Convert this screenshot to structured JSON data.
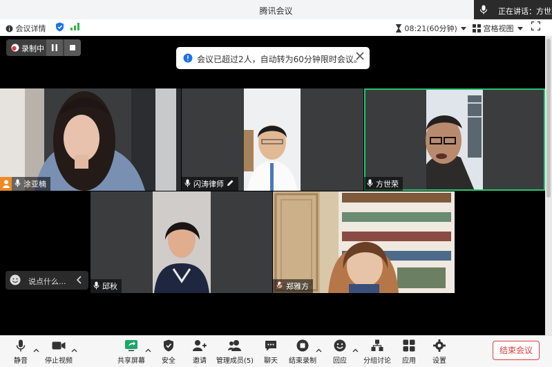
{
  "window": {
    "title": "腾讯会议"
  },
  "speaking": {
    "label": "正在讲话：方世荣"
  },
  "infobar": {
    "details_label": "会议详情",
    "time_label": "08:21(60分钟)",
    "view_label": "宫格视图"
  },
  "recording": {
    "label": "录制中"
  },
  "notice": {
    "text": "会议已超过2人，自动转为60分钟限时会议。"
  },
  "participants": [
    {
      "name": "涂亚楠"
    },
    {
      "name": "闪涛律师"
    },
    {
      "name": "方世荣"
    },
    {
      "name": "邱秋"
    },
    {
      "name": "郑雅方"
    }
  ],
  "chat": {
    "placeholder": "说点什么..."
  },
  "toolbar": {
    "mute": "静音",
    "stop_video": "停止视频",
    "share": "共享屏幕",
    "security": "安全",
    "invite": "邀请",
    "members": "管理成员(5)",
    "chat": "聊天",
    "end_record": "结束录制",
    "reaction": "回应",
    "breakout": "分组讨论",
    "apps": "应用",
    "settings": "设置",
    "end_meeting": "结束会议"
  },
  "colors": {
    "active_speaker": "#27c46d",
    "end_button": "#e3393b",
    "share_icon": "#1ca66b",
    "signal": "#2fb54a",
    "info": "#1a73e8"
  }
}
